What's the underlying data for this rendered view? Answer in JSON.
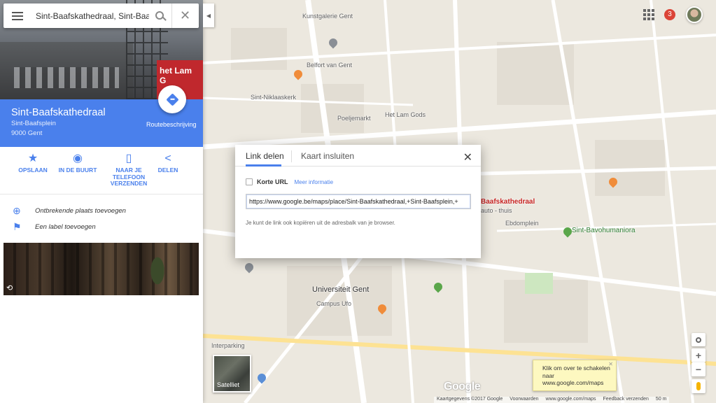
{
  "search": {
    "value": "Sint-Baafskathedraal, Sint-Baafsplein, Gent",
    "clear_glyph": "✕"
  },
  "panel": {
    "place_name": "Sint-Baafskathedraal",
    "address_street": "Sint-Baafsplein",
    "address_city": "9000 Gent",
    "route_label": "Routebeschrijving",
    "hero_banner": "het Lam G",
    "actions": [
      {
        "label": "OPSLAAN",
        "icon": "star-icon"
      },
      {
        "label": "IN DE BUURT",
        "icon": "nearby-icon"
      },
      {
        "label": "NAAR JE TELEFOON VERZENDEN",
        "icon": "phone-icon"
      },
      {
        "label": "DELEN",
        "icon": "share-icon"
      }
    ],
    "suggestions": [
      {
        "label": "Ontbrekende plaats toevoegen",
        "icon": "add-place-icon"
      },
      {
        "label": "Een label toevoegen",
        "icon": "flag-icon"
      }
    ]
  },
  "dialog": {
    "tab_link": "Link delen",
    "tab_embed": "Kaart insluiten",
    "short_url_label": "Korte URL",
    "more_info": "Meer informatie",
    "url_value": "https://www.google.be/maps/place/Sint-Baafskathedraal,+Sint-Baafsplein,+",
    "hint": "Je kunt de link ook kopiëren uit de adresbalk van je browser."
  },
  "map": {
    "notification_count": "3",
    "labels": [
      "Kunstgalerie Gent",
      "Belfort van Gent",
      "Sint-Niklaaskerk",
      "Poeljemarkt",
      "Het Lam Gods",
      "Baafskathedraal",
      "auto - thuis",
      "Ebdomplein",
      "Sint-Bavohumaniora",
      "Universiteit Gent",
      "Campus Ufo",
      "Interparking"
    ],
    "satellite_label": "Satelliet",
    "google_logo": "Google",
    "tooltip": "Klik om over te schakelen naar www.google.com/maps",
    "footer": {
      "copyright": "Kaartgegevens ©2017 Google",
      "terms": "Voorwaarden",
      "maps_link": "www.google.com/maps",
      "feedback": "Feedback verzenden",
      "scale": "50 m"
    }
  },
  "colors": {
    "accent": "#4a80ec",
    "place_block": "#4a80ec"
  }
}
